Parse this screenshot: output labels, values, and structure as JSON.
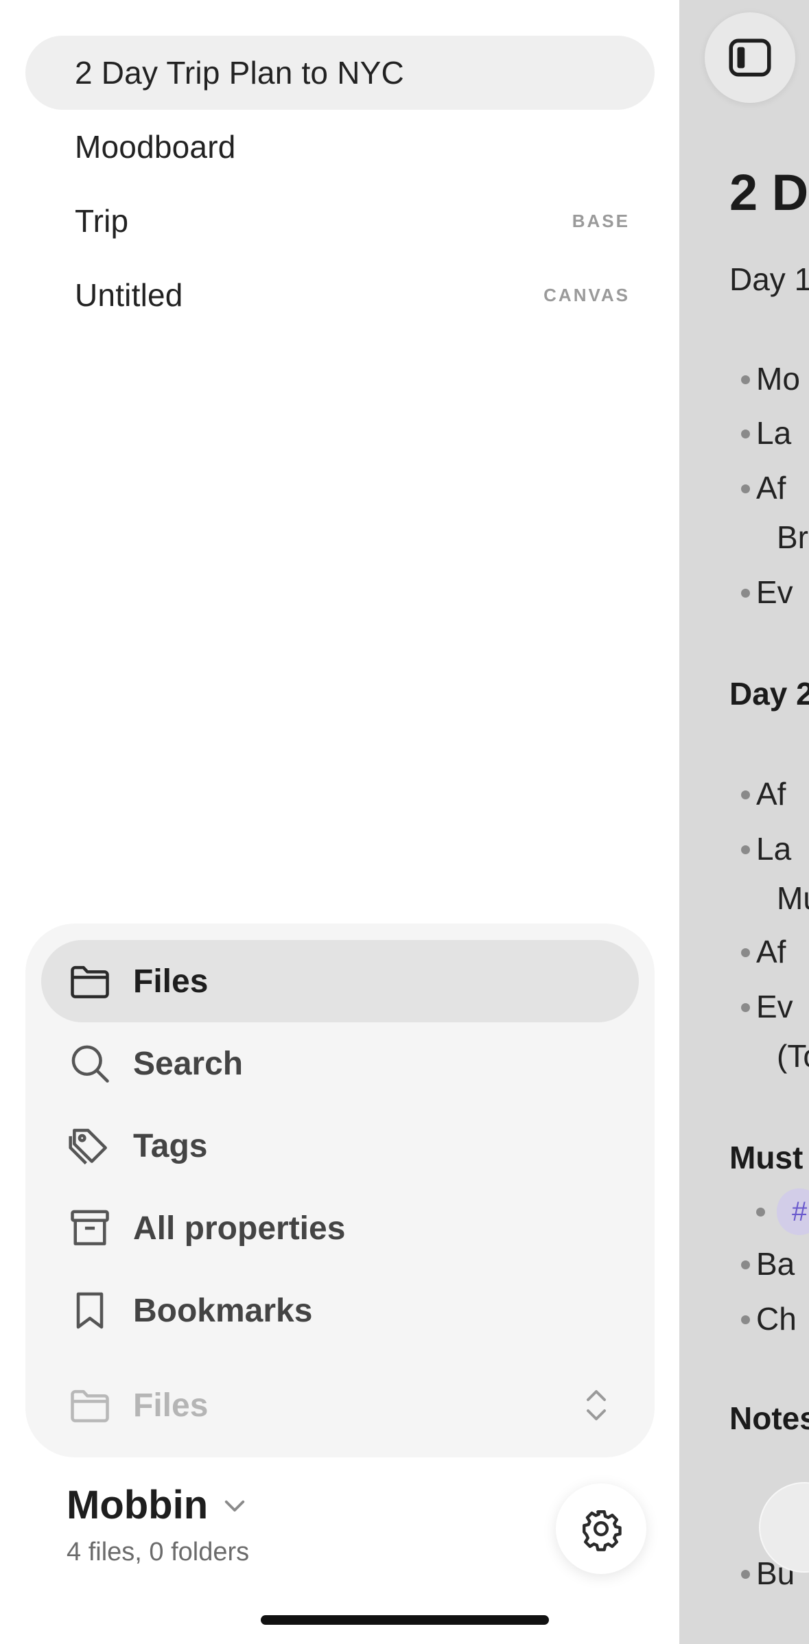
{
  "files": [
    {
      "name": "2 Day Trip Plan to NYC",
      "badge": "",
      "active": true
    },
    {
      "name": "Moodboard",
      "badge": ""
    },
    {
      "name": "Trip",
      "badge": "BASE"
    },
    {
      "name": "Untitled",
      "badge": "CANVAS"
    }
  ],
  "nav": {
    "files": "Files",
    "search": "Search",
    "tags": "Tags",
    "all_properties": "All properties",
    "bookmarks": "Bookmarks",
    "files_switcher": "Files"
  },
  "vault": {
    "name": "Mobbin",
    "stats": "4 files, 0 folders"
  },
  "editor": {
    "title": "2 D",
    "day1": "Day 1",
    "day1_items": [
      "Mo",
      "La",
      "Af",
      "Ev"
    ],
    "day1_item3_cont": "Br",
    "day2": "Day 2",
    "day2_items": [
      "Af",
      "La",
      "Af",
      "Ev"
    ],
    "day2_item2_cont": "Mu",
    "day2_item4_cont": "(To",
    "must_heading": "Must",
    "must_tag": "#",
    "must_items": [
      "Ba",
      "Ch"
    ],
    "notes_heading": "Notes",
    "notes_item": "Bu"
  },
  "colors": {
    "sidebar_bg": "#ffffff",
    "nav_panel_bg": "#f5f5f5",
    "active_item_bg": "#efefef",
    "editor_dim_bg": "#d9d9d9",
    "tag_accent": "#6a5acd"
  }
}
